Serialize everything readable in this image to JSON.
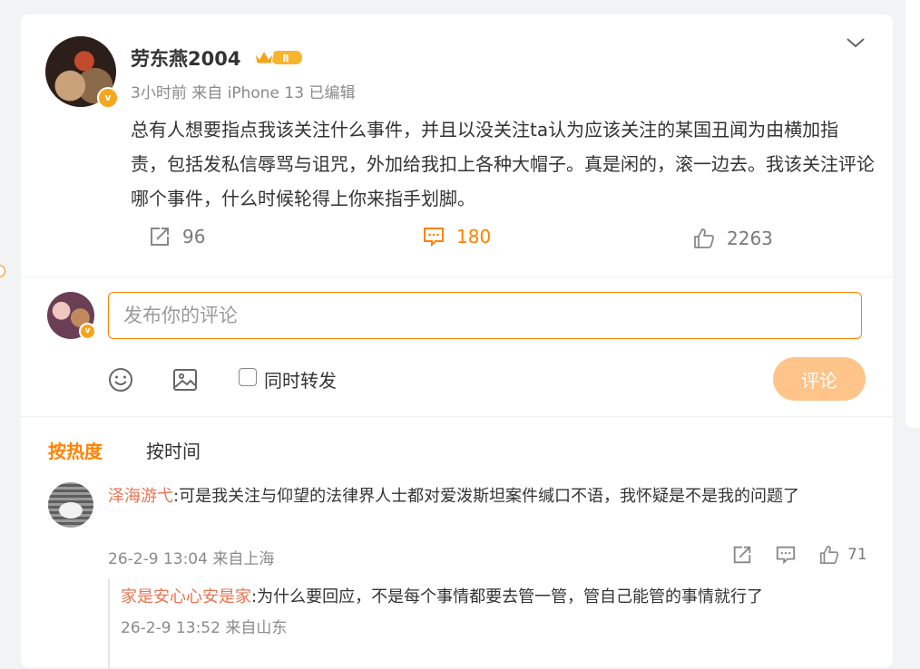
{
  "post": {
    "username": "劳东燕2004",
    "rank_badge": "Ⅱ",
    "verified_badge": "v",
    "meta": "3小时前  来自 iPhone 13 已编辑",
    "text": "总有人想要指点我该关注什么事件，并且以没关注ta认为应该关注的某国丑闻为由横加指责，包括发私信辱骂与诅咒，外加给我扣上各种大帽子。真是闲的，滚一边去。我该关注评论哪个事件，什么时候轮得上你来指手划脚。",
    "actions": {
      "repost_count": "96",
      "comment_count": "180",
      "like_count": "2263"
    }
  },
  "composer": {
    "placeholder": "发布你的评论",
    "also_repost_label": "同时转发",
    "submit_label": "评论",
    "verified_badge": "v"
  },
  "sort": {
    "hot": "按热度",
    "time": "按时间"
  },
  "comments": [
    {
      "user": "泽海游弋",
      "text": ":可是我关注与仰望的法律界人士都对爱泼斯坦案件缄口不语，我怀疑是不是我的问题了",
      "meta": "26-2-9 13:04 来自上海",
      "like_count": "71",
      "replies": [
        {
          "user": "家是安心心安是家",
          "text": ":为什么要回应，不是每个事情都要去管一管，管自己能管的事情就行了",
          "meta": "26-2-9 13:52 来自山东"
        }
      ]
    }
  ],
  "colors": {
    "accent": "#ff8200",
    "username_link": "#eb7350",
    "submit_disabled": "#ffc48a",
    "verified": "#f6a61d"
  },
  "icons": [
    "chevron-down-icon",
    "repost-icon",
    "comment-icon",
    "like-icon",
    "emoji-icon",
    "image-icon",
    "rank-crown-icon"
  ]
}
